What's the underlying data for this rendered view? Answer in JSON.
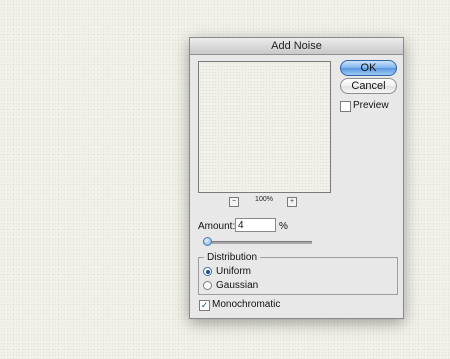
{
  "dialog": {
    "title": "Add Noise",
    "preview": {
      "zoom_out_symbol": "−",
      "zoom_in_symbol": "+",
      "zoom_level": "100%"
    },
    "buttons": {
      "ok_label": "OK",
      "cancel_label": "Cancel"
    },
    "preview_option": {
      "label": "Preview",
      "checked": false
    },
    "amount": {
      "label": "Amount:",
      "value": "4",
      "unit": "%",
      "slider_fraction": 0.04
    },
    "distribution": {
      "label": "Distribution",
      "options": [
        {
          "label": "Uniform",
          "selected": true
        },
        {
          "label": "Gaussian",
          "selected": false
        }
      ]
    },
    "monochromatic": {
      "label": "Monochromatic",
      "checked": true,
      "check_mark": "✓"
    }
  },
  "colors": {
    "accent": "#5796e2",
    "dialog_bg": "#e8e8e8",
    "canvas_bg": "#f2f2ea"
  },
  "icons": {
    "zoom_out": "minus-icon",
    "zoom_in": "plus-icon",
    "check": "checkmark-icon"
  }
}
